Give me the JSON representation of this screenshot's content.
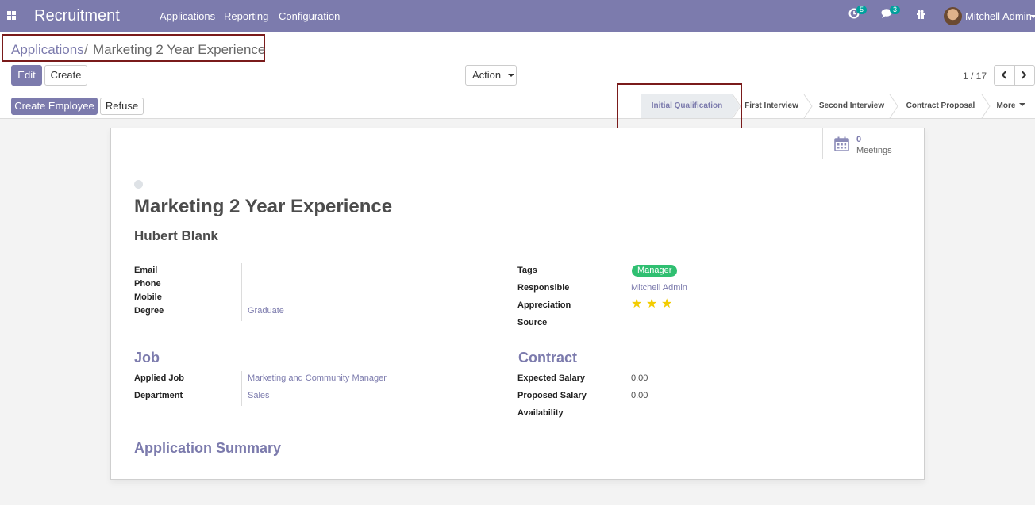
{
  "navbar": {
    "brand": "Recruitment",
    "menus": [
      "Applications",
      "Reporting",
      "Configuration"
    ],
    "activity_count": "5",
    "message_count": "3",
    "user": "Mitchell Admin"
  },
  "breadcrumb": {
    "parent": "Applications",
    "separator": "/",
    "current": "Marketing 2 Year Experience"
  },
  "buttons": {
    "edit": "Edit",
    "create": "Create",
    "action": "Action",
    "create_employee": "Create Employee",
    "refuse": "Refuse"
  },
  "pager": {
    "value": "1 / 17"
  },
  "stages": [
    {
      "label": "Initial Qualification",
      "active": true
    },
    {
      "label": "First Interview",
      "active": false
    },
    {
      "label": "Second Interview",
      "active": false
    },
    {
      "label": "Contract Proposal",
      "active": false
    }
  ],
  "more_label": "More",
  "meetings": {
    "count": "0",
    "label": "Meetings"
  },
  "record": {
    "title": "Marketing 2 Year Experience",
    "partner": "Hubert Blank"
  },
  "fields": {
    "email_label": "Email",
    "email": "",
    "phone_label": "Phone",
    "phone": "",
    "mobile_label": "Mobile",
    "mobile": "",
    "degree_label": "Degree",
    "degree": "Graduate",
    "tags_label": "Tags",
    "tag": "Manager",
    "responsible_label": "Responsible",
    "responsible": "Mitchell Admin",
    "appreciation_label": "Appreciation",
    "appreciation_stars": 3,
    "source_label": "Source",
    "source": ""
  },
  "job": {
    "section": "Job",
    "applied_job_label": "Applied Job",
    "applied_job": "Marketing and Community Manager",
    "department_label": "Department",
    "department": "Sales"
  },
  "contract": {
    "section": "Contract",
    "expected_label": "Expected Salary",
    "expected": "0.00",
    "proposed_label": "Proposed Salary",
    "proposed": "0.00",
    "availability_label": "Availability",
    "availability": ""
  },
  "summary_section": "Application Summary",
  "colors": {
    "brand": "#7c7bad",
    "tag_green": "#2fbf71",
    "star": "#f3cc00",
    "highlight_border": "#7a1b1b"
  }
}
